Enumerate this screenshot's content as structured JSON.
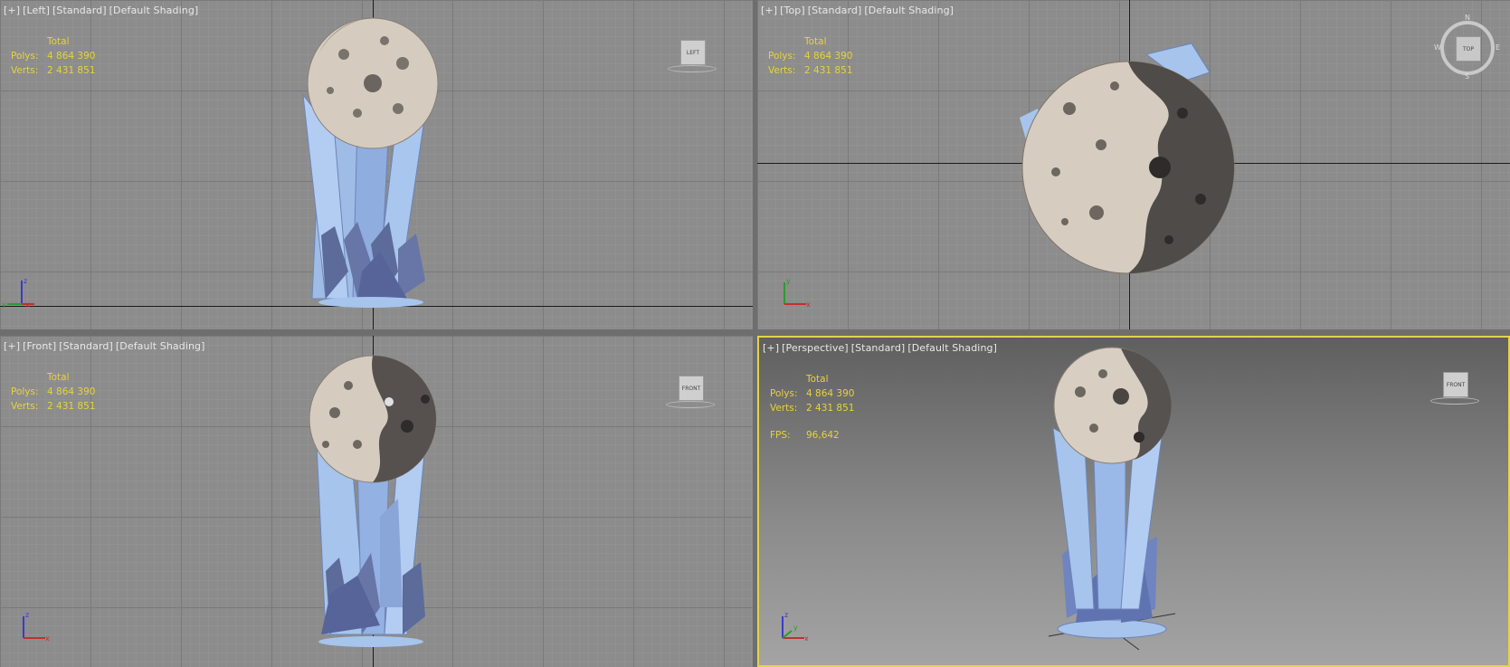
{
  "stats": {
    "header": "Total",
    "polys_label": "Polys:",
    "polys": "4 864 390",
    "verts_label": "Verts:",
    "verts": "2 431 851",
    "fps_label": "FPS:",
    "fps": "96,642"
  },
  "viewports": {
    "left": {
      "menu": "[+]",
      "view": "[Left]",
      "preset": "[Standard]",
      "shading": "[Default Shading]",
      "cube_label": "LEFT"
    },
    "top": {
      "menu": "[+]",
      "view": "[Top]",
      "preset": "[Standard]",
      "shading": "[Default Shading]",
      "cube_label": "TOP",
      "compass": {
        "n": "N",
        "s": "S",
        "e": "E",
        "w": "W"
      }
    },
    "front": {
      "menu": "[+]",
      "view": "[Front]",
      "preset": "[Standard]",
      "shading": "[Default Shading]",
      "cube_label": "FRONT"
    },
    "persp": {
      "menu": "[+]",
      "view": "[Perspective]",
      "preset": "[Standard]",
      "shading": "[Default Shading]",
      "cube_label": "FRONT",
      "active": true
    }
  },
  "axes": {
    "x": "x",
    "y": "y",
    "z": "z"
  },
  "colors": {
    "active_border": "#e3d34a",
    "stats_text": "#e7d23c",
    "moon_light": "#d8cfc2",
    "moon_dark": "#565250",
    "crystal": "#a7c4ec",
    "crystal_dark": "#5d6c99"
  }
}
